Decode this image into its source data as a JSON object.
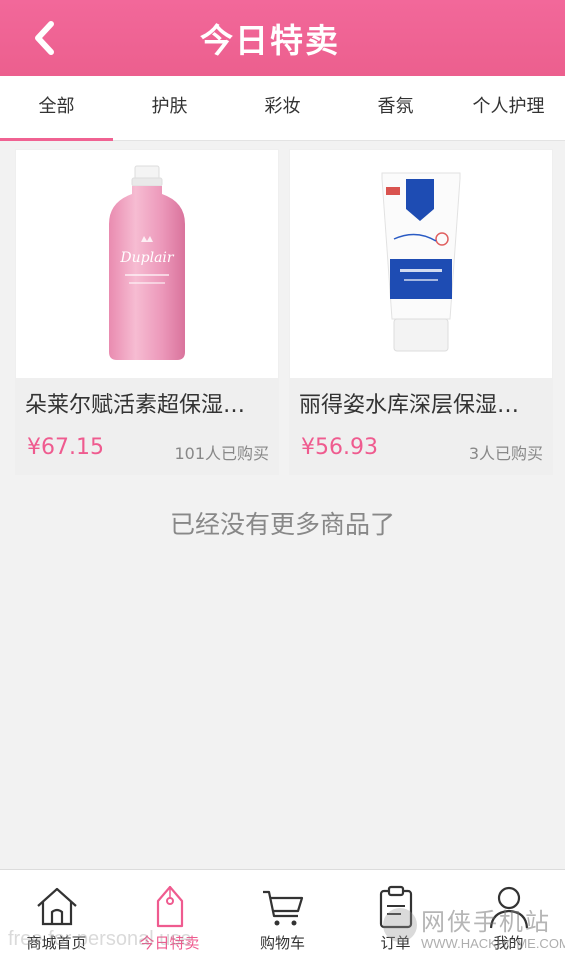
{
  "header": {
    "title": "今日特卖"
  },
  "tabs": [
    {
      "label": "全部",
      "active": true
    },
    {
      "label": "护肤"
    },
    {
      "label": "彩妆"
    },
    {
      "label": "香氛"
    },
    {
      "label": "个人护理"
    }
  ],
  "products": [
    {
      "name": "朵莱尔赋活素超保湿…",
      "price": "¥67.15",
      "sold": "101人已购买",
      "image": "pink-toner-bottle",
      "brand_label": "Duplair"
    },
    {
      "name": "丽得姿水库深层保湿…",
      "price": "¥56.93",
      "sold": "3人已购买",
      "image": "blue-cleanser-tube"
    }
  ],
  "list_footer": "已经没有更多商品了",
  "bottom_nav": [
    {
      "label": "商城首页",
      "icon": "home-icon"
    },
    {
      "label": "今日特卖",
      "icon": "tag-icon",
      "active": true
    },
    {
      "label": "购物车",
      "icon": "cart-icon"
    },
    {
      "label": "订单",
      "icon": "clipboard-icon"
    },
    {
      "label": "我的",
      "icon": "user-icon"
    }
  ],
  "watermark": {
    "left": "free for personal use",
    "right_title": "网侠手机站",
    "right_url": "WWW.HACKHOME.COM"
  },
  "colors": {
    "accent": "#f06292",
    "price": "#ef5b8f"
  }
}
